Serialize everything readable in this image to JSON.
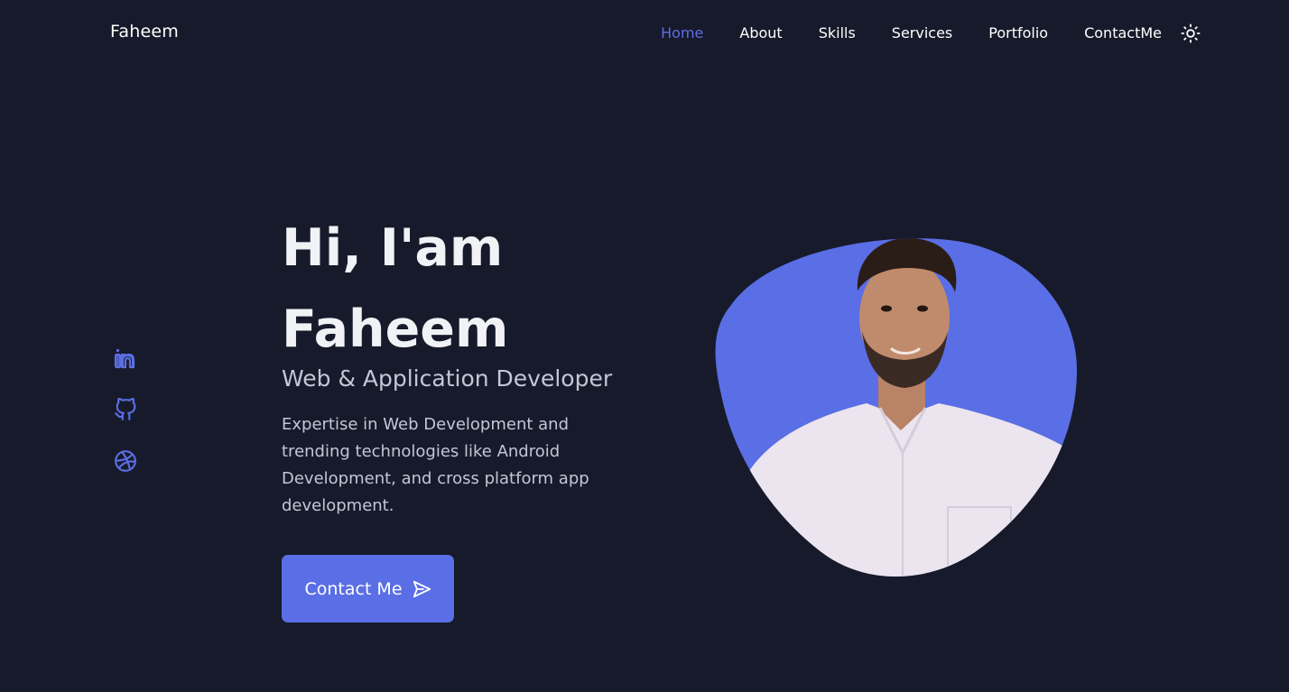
{
  "header": {
    "logo": "Faheem",
    "nav": [
      {
        "label": "Home",
        "active": true
      },
      {
        "label": "About",
        "active": false
      },
      {
        "label": "Skills",
        "active": false
      },
      {
        "label": "Services",
        "active": false
      },
      {
        "label": "Portfolio",
        "active": false
      },
      {
        "label": "ContactMe",
        "active": false
      }
    ],
    "theme_icon": "sun-icon"
  },
  "socials": [
    {
      "icon": "linkedin-icon"
    },
    {
      "icon": "github-icon"
    },
    {
      "icon": "dribbble-icon"
    }
  ],
  "hero": {
    "title_line1": "Hi, I'am",
    "title_line2": "Faheem",
    "subtitle": "Web & Application Developer",
    "description": "Expertise in Web Development and trending technologies like Android Development, and cross platform app development.",
    "cta_label": "Contact Me",
    "cta_icon": "send-icon"
  },
  "colors": {
    "background": "#171a2a",
    "accent": "#5a6ee5",
    "text_primary": "#ffffff",
    "text_secondary": "#c3c6d6"
  }
}
